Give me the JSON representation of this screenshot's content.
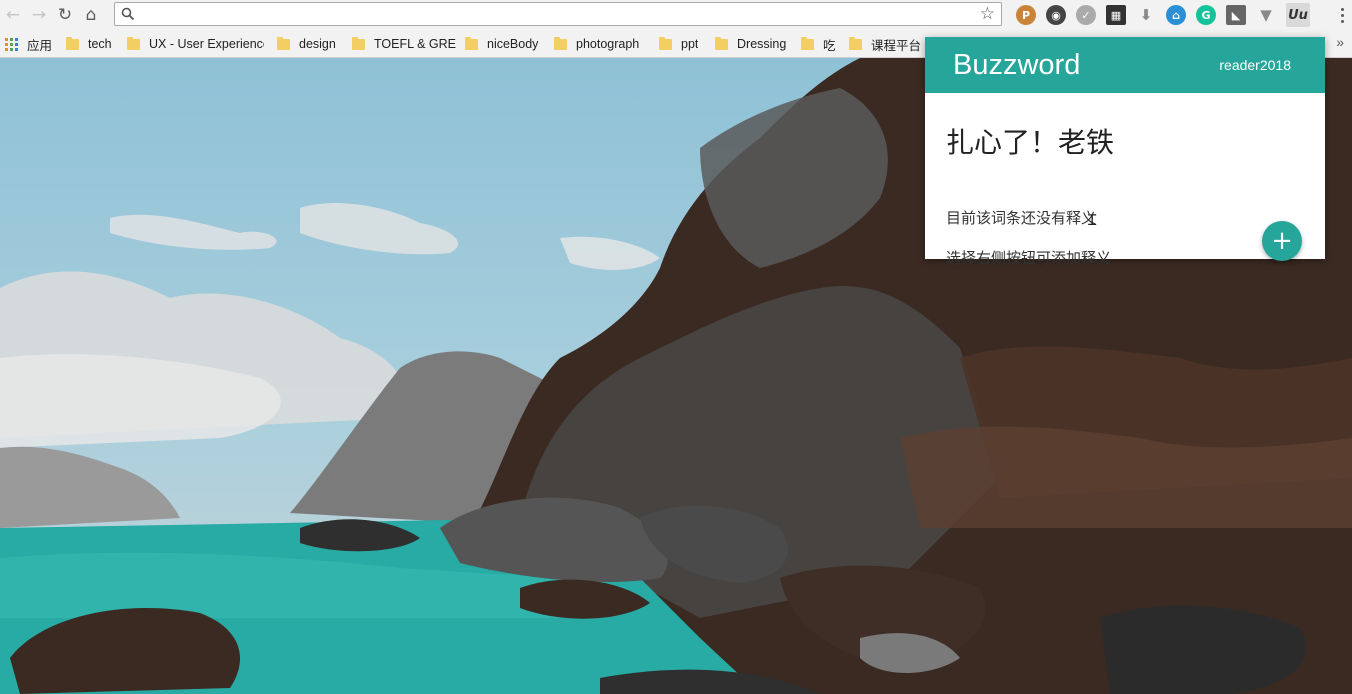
{
  "browser": {
    "address_value": "",
    "extensions": [
      {
        "name": "pocket",
        "glyph": "P",
        "color": "#c9843a"
      },
      {
        "name": "ghostery",
        "glyph": "◉",
        "color": "#444444"
      },
      {
        "name": "checker",
        "glyph": "✓",
        "color": "#aaaaaa"
      },
      {
        "name": "qr-code",
        "glyph": "▦",
        "color": "#333333"
      },
      {
        "name": "download",
        "glyph": "⬇",
        "color": "#a6a6a6"
      },
      {
        "name": "museum",
        "glyph": "⌂",
        "color": "#2a8fd4"
      },
      {
        "name": "grammarly",
        "glyph": "G",
        "color": "#15c39a"
      },
      {
        "name": "image-search",
        "glyph": "◣",
        "color": "#666666"
      },
      {
        "name": "vimium",
        "glyph": "▼",
        "color": "#aaaaaa"
      },
      {
        "name": "buzzword",
        "glyph": "Uu",
        "color": "#d9d9d9"
      }
    ]
  },
  "bookmarks": {
    "items": [
      {
        "label": "应用",
        "type": "apps"
      },
      {
        "label": "tech",
        "type": "folder"
      },
      {
        "label": "UX - User Experience",
        "type": "folder"
      },
      {
        "label": "design",
        "type": "folder"
      },
      {
        "label": "TOEFL & GRE",
        "type": "folder"
      },
      {
        "label": "niceBody",
        "type": "folder"
      },
      {
        "label": "photograph",
        "type": "folder"
      },
      {
        "label": "ppt",
        "type": "folder"
      },
      {
        "label": "Dressing",
        "type": "folder"
      },
      {
        "label": "吃",
        "type": "folder"
      },
      {
        "label": "课程平台",
        "type": "folder"
      }
    ],
    "overflow": "»"
  },
  "popup": {
    "title": "Buzzword",
    "user": "reader2018",
    "term": "扎心了！老铁",
    "empty_message": "目前该词条还没有释义",
    "hint_message": "选择右侧按钮可添加释义",
    "add_button": "+",
    "accent_color": "#26a69a"
  }
}
